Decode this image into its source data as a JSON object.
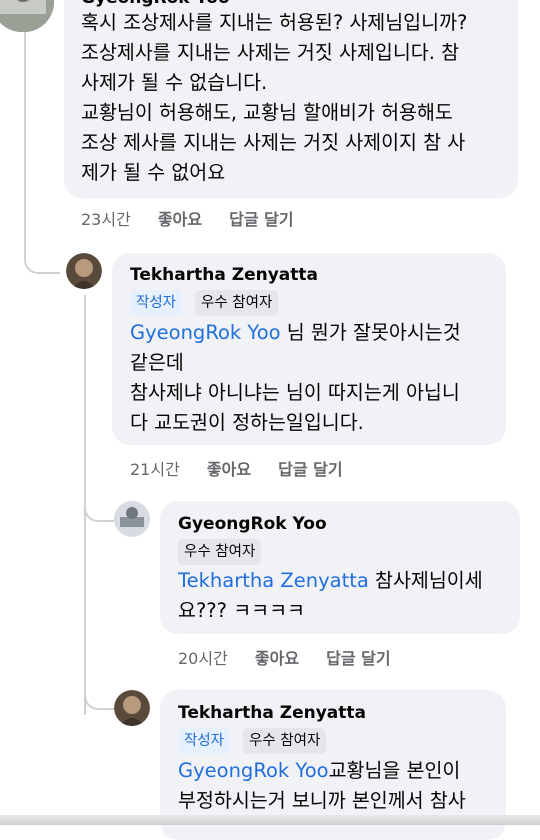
{
  "comments": [
    {
      "author": "GyeongRok Yoo",
      "lines": [
        "혹시 조상제사를 지내는 허용된? 사제님입니까?",
        "조상제사를 지내는 사제는 거짓 사제입니다. 참",
        "사제가 될 수 없습니다.",
        "교황님이 허용해도, 교황님 할애비가 허용해도",
        "조상 제사를 지내는 사제는 거짓 사제이지 참 사",
        "제가 될 수 없어요"
      ],
      "time": "23시간",
      "like": "좋아요",
      "reply": "답글 달기"
    },
    {
      "author": "Tekhartha Zenyatta",
      "badges": [
        "작성자",
        "우수 참여자"
      ],
      "mention": "GyeongRok Yoo",
      "lines": [
        " 님 뭔가 잘못아시는것",
        "같은데",
        "참사제냐 아니냐는 님이 따지는게 아닙니",
        "다 교도권이 정하는일입니다."
      ],
      "time": "21시간",
      "like": "좋아요",
      "reply": "답글 달기"
    },
    {
      "author": "GyeongRok Yoo",
      "badges": [
        "우수 참여자"
      ],
      "mention": "Tekhartha Zenyatta",
      "lines": [
        " 참사제님이세",
        "요??? ㅋㅋㅋㅋ"
      ],
      "time": "20시간",
      "like": "좋아요",
      "reply": "답글 달기"
    },
    {
      "author": "Tekhartha Zenyatta",
      "badges": [
        "작성자",
        "우수 참여자"
      ],
      "mention": "GyeongRok Yoo",
      "lines": [
        "교황님을 본인이",
        "부정하시는거 보니까 본인께서 참사"
      ]
    }
  ],
  "colors": {
    "mention": "#216fdb",
    "bubble": "#f0f2f5",
    "meta": "#65676b",
    "thread_line": "#ced0d4"
  }
}
